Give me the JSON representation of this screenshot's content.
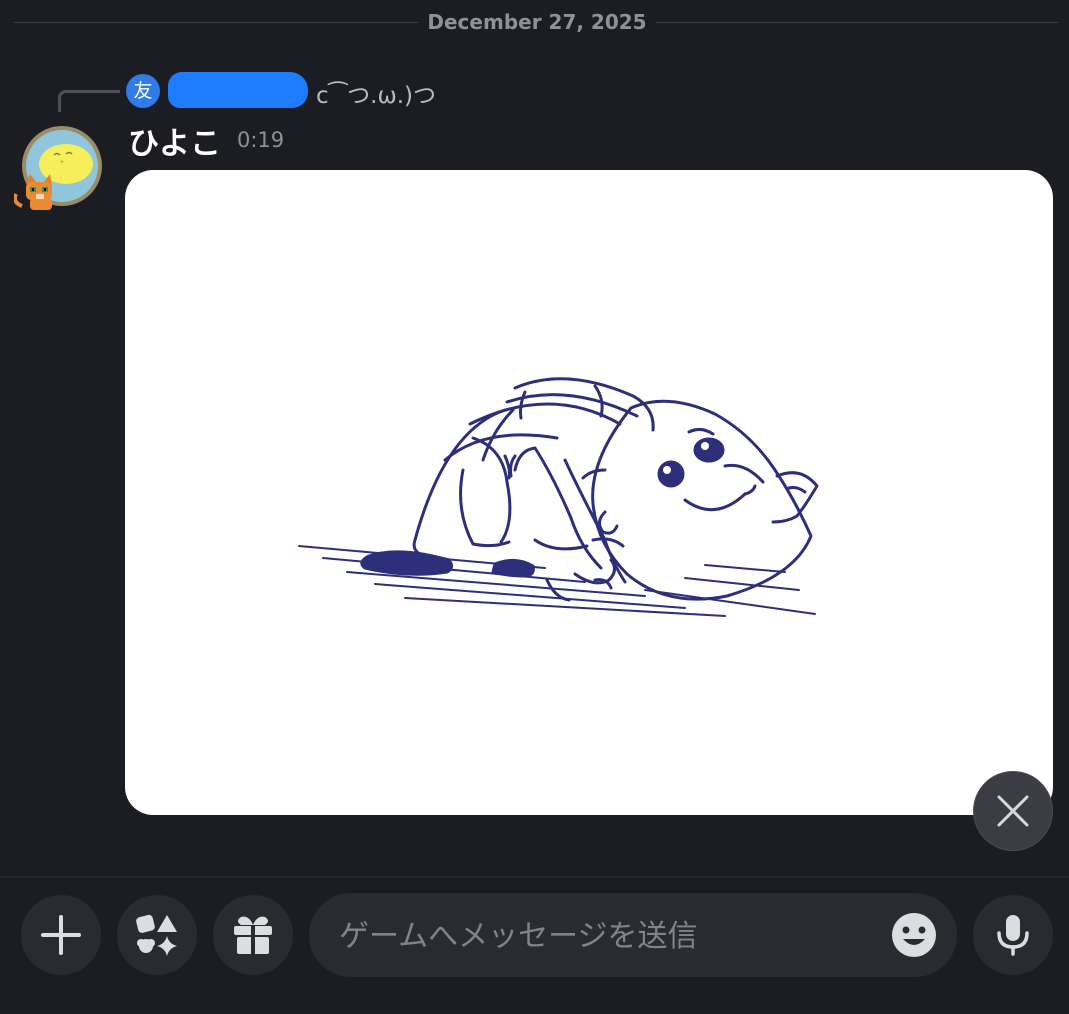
{
  "date_divider": "December 27, 2025",
  "reply": {
    "avatar_char": "友",
    "preview_text": "c⁀つ.ω.)つ"
  },
  "message": {
    "author": "ひよこ",
    "time": "0:19"
  },
  "composer": {
    "placeholder": "ゲームへメッセージを送信"
  },
  "icons": {
    "close": "close-icon",
    "plus": "plus-icon",
    "apps": "apps-icon",
    "gift": "gift-icon",
    "emoji": "emoji-icon",
    "mic": "microphone-icon"
  },
  "colors": {
    "background": "#1c1d23",
    "surface": "#2a2b31",
    "reply_redaction": "#1f7cff",
    "sketch_ink": "#2e2f7a"
  }
}
